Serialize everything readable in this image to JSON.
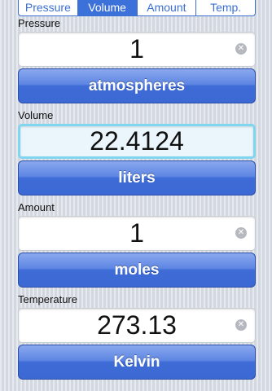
{
  "tabs": [
    {
      "label": "Pressure",
      "active": false
    },
    {
      "label": "Volume",
      "active": true
    },
    {
      "label": "Amount",
      "active": false
    },
    {
      "label": "Temp.",
      "active": false
    }
  ],
  "sections": [
    {
      "label": "Pressure",
      "value": "1",
      "unit": "atmospheres",
      "focused": false
    },
    {
      "label": "Volume",
      "value": "22.4124",
      "unit": "liters",
      "focused": true
    },
    {
      "label": "Amount",
      "value": "1",
      "unit": "moles",
      "focused": false
    },
    {
      "label": "Temperature",
      "value": "273.13",
      "unit": "Kelvin",
      "focused": false
    }
  ],
  "clear_glyph": "✕",
  "colors": {
    "accent": "#3b71d8",
    "focus_border": "#7fd6ee",
    "focus_fill": "#eaf6fb"
  }
}
